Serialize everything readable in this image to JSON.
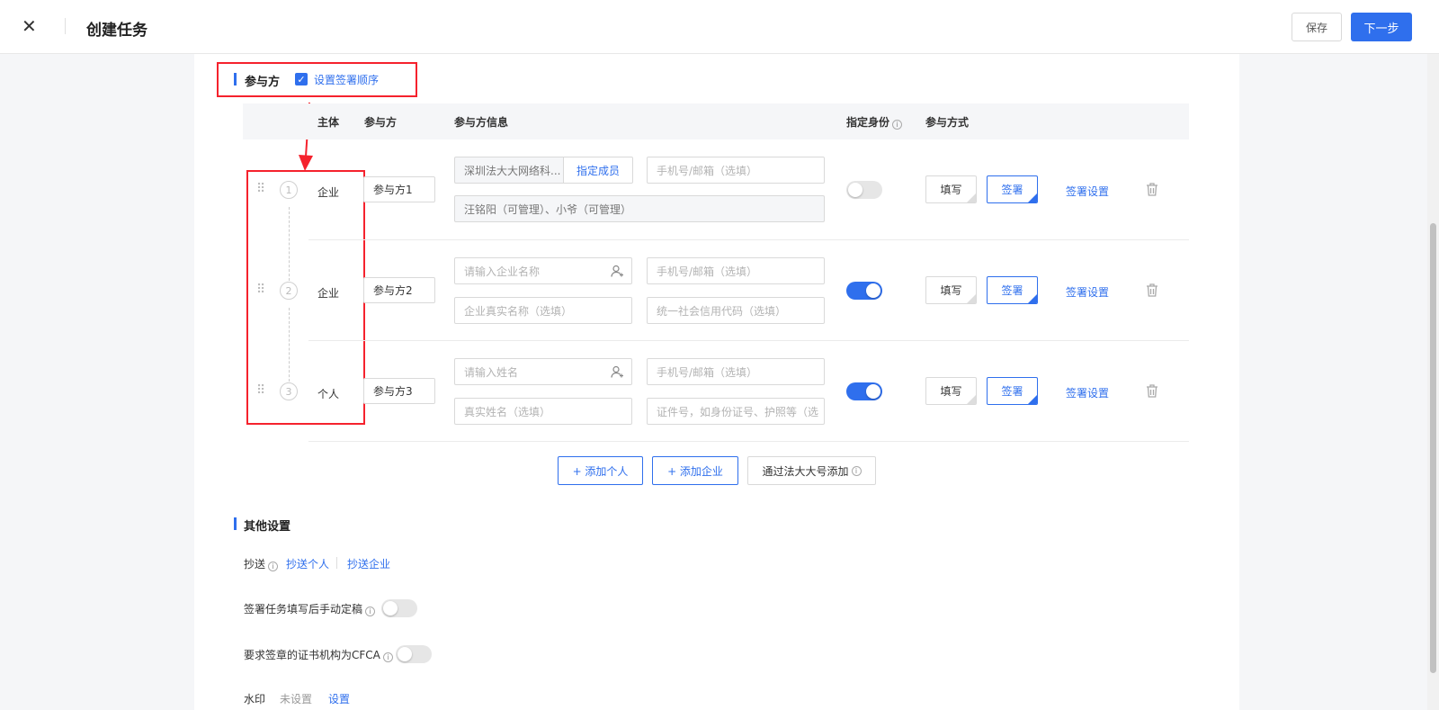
{
  "header": {
    "title": "创建任务",
    "save_label": "保存",
    "next_label": "下一步"
  },
  "participants_section": {
    "title": "参与方",
    "sign_order_label": "设置签署顺序",
    "sign_order_checked": true,
    "columns": {
      "subject": "主体",
      "party": "参与方",
      "info": "参与方信息",
      "identity": "指定身份",
      "mode": "参与方式"
    },
    "rows": [
      {
        "index": "1",
        "subject": "企业",
        "party": "参与方1",
        "company": "深圳法大大网络科...",
        "assign_label": "指定成员",
        "contact_placeholder": "手机号/邮箱（选填）",
        "members": "汪铭阳（可管理）、小爷（可管理）",
        "identity_on": false,
        "fill_label": "填写",
        "sign_label": "签署",
        "settings_label": "签署设置"
      },
      {
        "index": "2",
        "subject": "企业",
        "party": "参与方2",
        "name_placeholder": "请输入企业名称",
        "contact_placeholder": "手机号/邮箱（选填）",
        "realname_placeholder": "企业真实名称（选填）",
        "code_placeholder": "统一社会信用代码（选填）",
        "identity_on": true,
        "fill_label": "填写",
        "sign_label": "签署",
        "settings_label": "签署设置"
      },
      {
        "index": "3",
        "subject": "个人",
        "party": "参与方3",
        "name_placeholder": "请输入姓名",
        "contact_placeholder": "手机号/邮箱（选填）",
        "realname_placeholder": "真实姓名（选填）",
        "code_placeholder": "证件号，如身份证号、护照等（选",
        "identity_on": true,
        "fill_label": "填写",
        "sign_label": "签署",
        "settings_label": "签署设置"
      }
    ],
    "add_person_label": "+ 添加个人",
    "add_company_label": "+ 添加企业",
    "add_fadada_label": "通过法大大号添加"
  },
  "other_settings": {
    "title": "其他设置",
    "cc_label": "抄送",
    "cc_person": "抄送个人",
    "cc_company": "抄送企业",
    "manual_finalize_label": "签署任务填写后手动定稿",
    "manual_finalize_on": false,
    "cfca_label": "要求签章的证书机构为CFCA",
    "cfca_on": false,
    "watermark_label": "水印",
    "watermark_status": "未设置",
    "watermark_set": "设置"
  },
  "colors": {
    "accent": "#2f6fed",
    "annotation": "#f5222d"
  }
}
